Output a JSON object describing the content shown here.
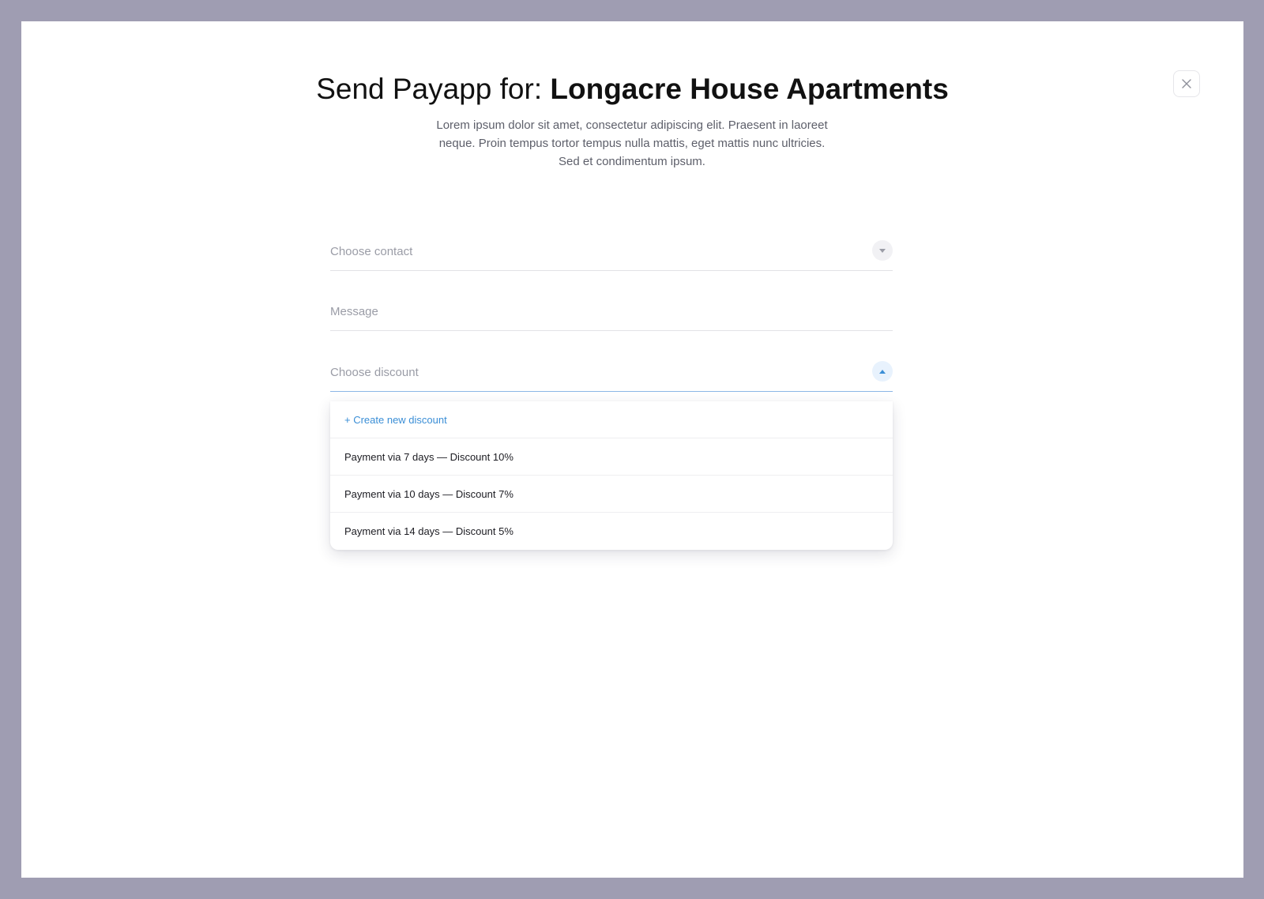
{
  "modal": {
    "title_prefix": "Send Payapp for:",
    "title_name": "Longacre House Apartments",
    "description": "Lorem ipsum dolor sit amet, consectetur adipiscing elit. Praesent in laoreet neque. Proin tempus tortor tempus nulla mattis, eget mattis nunc ultricies. Sed et condimentum ipsum.",
    "close_icon": "close-icon"
  },
  "form": {
    "contact_placeholder": "Choose contact",
    "message_placeholder": "Message",
    "discount_placeholder": "Choose discount",
    "contact_toggle_icon": "chevron-down-icon",
    "discount_toggle_icon": "chevron-up-icon"
  },
  "discount_dropdown": {
    "create_label": "+ Create new discount",
    "options": [
      "Payment via 7 days — Discount 10%",
      "Payment via 10 days — Discount 7%",
      "Payment via 14 days — Discount 5%"
    ]
  },
  "colors": {
    "backdrop": "#9f9db2",
    "accent": "#3a8ed6",
    "active_underline": "#8cb6e6"
  }
}
